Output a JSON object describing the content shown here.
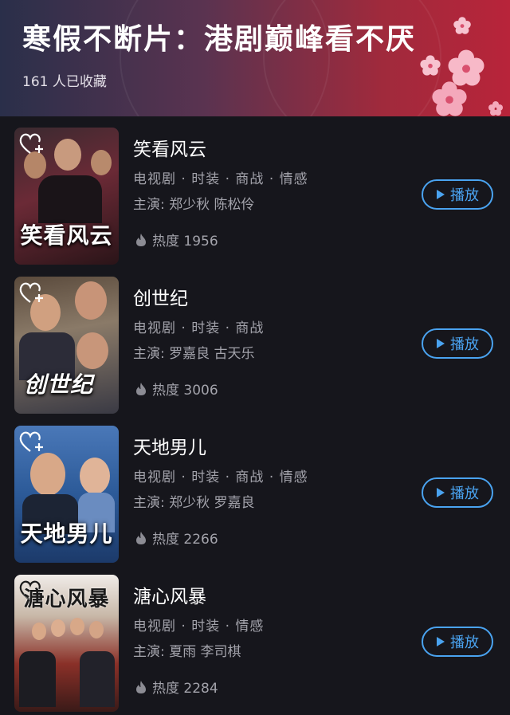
{
  "header": {
    "title": "寒假不断片：港剧巅峰看不厌",
    "collect_count": "161 人已收藏"
  },
  "colors": {
    "accent_blue": "#4aa3f0",
    "background": "#16161c",
    "muted_text": "#a3a3ab"
  },
  "items": [
    {
      "name": "笑看风云",
      "poster_title": "笑看风云",
      "tags": "电视剧 · 时装 · 商战 · 情感",
      "cast": "主演: 郑少秋 陈松伶",
      "heat": "热度 1956",
      "play_label": "播放"
    },
    {
      "name": "创世纪",
      "poster_title": "创世纪",
      "tags": "电视剧 · 时装 · 商战",
      "cast": "主演: 罗嘉良 古天乐",
      "heat": "热度 3006",
      "play_label": "播放"
    },
    {
      "name": "天地男儿",
      "poster_title": "天地男儿",
      "tags": "电视剧 · 时装 · 商战 · 情感",
      "cast": "主演: 郑少秋 罗嘉良",
      "heat": "热度 2266",
      "play_label": "播放"
    },
    {
      "name": "溏心风暴",
      "poster_title": "溏心风暴",
      "tags": "电视剧 · 时装 · 情感",
      "cast": "主演: 夏雨 李司棋",
      "heat": "热度 2284",
      "play_label": "播放"
    }
  ]
}
